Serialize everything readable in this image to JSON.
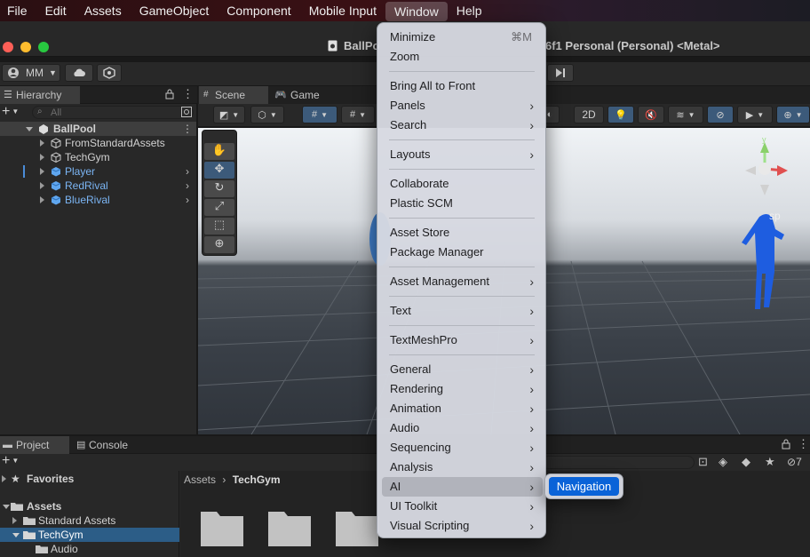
{
  "menubar": {
    "items": [
      "File",
      "Edit",
      "Assets",
      "GameObject",
      "Component",
      "Mobile Input",
      "Window",
      "Help"
    ],
    "active": "Window"
  },
  "window": {
    "title_left": "BallPo",
    "title_right": "6f1 Personal (Personal) <Metal>"
  },
  "toolbar": {
    "account_label": "MM"
  },
  "hierarchy": {
    "tab_label": "Hierarchy",
    "search_placeholder": "All",
    "root": "BallPool",
    "children": [
      "FromStandardAssets",
      "TechGym",
      "Player",
      "RedRival",
      "BlueRival"
    ]
  },
  "scene": {
    "tabs": [
      "Scene",
      "Game"
    ],
    "mode_2d": "2D",
    "persp_label": "sp"
  },
  "project": {
    "tabs": [
      "Project",
      "Console"
    ],
    "hidden_count": "7",
    "favorites_label": "Favorites",
    "tree": [
      "Assets",
      "Standard Assets",
      "TechGym",
      "Audio"
    ],
    "breadcrumb": [
      "Assets",
      "TechGym"
    ]
  },
  "window_menu": {
    "minimize": "Minimize",
    "minimize_shortcut": "⌘M",
    "zoom": "Zoom",
    "bring_all": "Bring All to Front",
    "panels": "Panels",
    "search": "Search",
    "layouts": "Layouts",
    "collaborate": "Collaborate",
    "plastic": "Plastic SCM",
    "asset_store": "Asset Store",
    "package_manager": "Package Manager",
    "asset_management": "Asset Management",
    "text": "Text",
    "textmeshpro": "TextMeshPro",
    "general": "General",
    "rendering": "Rendering",
    "animation": "Animation",
    "audio": "Audio",
    "sequencing": "Sequencing",
    "analysis": "Analysis",
    "ai": "AI",
    "ui_toolkit": "UI Toolkit",
    "visual_scripting": "Visual Scripting"
  },
  "ai_submenu": {
    "navigation": "Navigation"
  },
  "colors": {
    "highlight": "#0a63d8",
    "selected_row": "#2c5d87",
    "prefab_blue": "#7bb5f4"
  }
}
